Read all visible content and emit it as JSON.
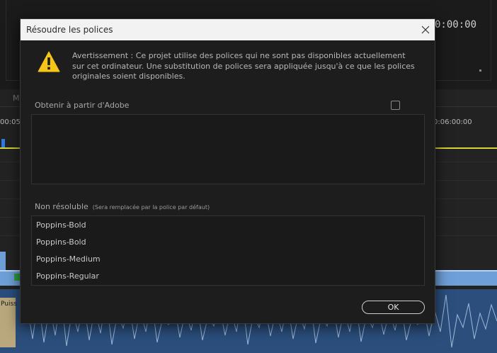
{
  "background": {
    "monitor_timecode": "0:00:00",
    "tab_letter": "M",
    "ruler_timecode_left": "00:05:",
    "ruler_timecode_right": "0:06:00:00",
    "audio_clip_label": "Puiss"
  },
  "dialog": {
    "title": "Résoudre les polices",
    "warning_text": "Avertissement : Ce projet utilise des polices qui ne sont pas disponibles actuellement sur cet ordinateur. Une substitution de polices sera appliquée jusqu'à ce que les polices originales soient disponibles.",
    "adobe_section": {
      "label": "Obtenir à partir d'Adobe",
      "checked": false
    },
    "unresolved_section": {
      "label": "Non résoluble",
      "sublabel": "(Sera remplacée par la police par défaut)",
      "fonts": [
        "Poppins-Bold",
        "Poppins-Bold",
        "Poppins-Medium",
        "Poppins-Regular"
      ]
    },
    "ok_label": "OK"
  },
  "icons": {
    "warning": "warning-triangle-icon",
    "close": "close-icon"
  },
  "colors": {
    "warning_yellow": "#f5c518",
    "playhead_line": "#d8d43a",
    "video_clip": "#6e9fd8",
    "audio_clip": "#2b4e7c"
  }
}
